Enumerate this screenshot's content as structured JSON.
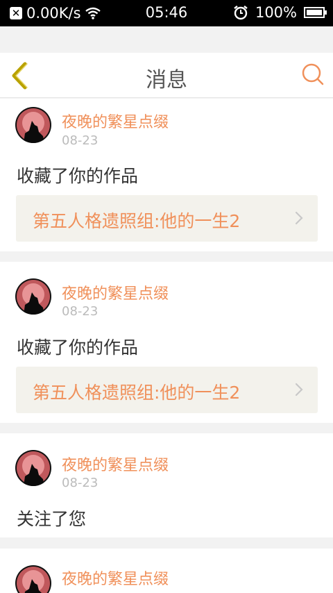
{
  "status_bar": {
    "speed": "0.00K/s",
    "time": "05:46",
    "battery": "100%",
    "icons": [
      "close-box-icon",
      "wifi-icon",
      "alarm-clock-icon",
      "battery-icon"
    ]
  },
  "nav": {
    "title": "消息",
    "back_icon": "chevron-left-icon",
    "search_icon": "search-icon",
    "accent_color": "#f0905a",
    "back_color": "#b9a200"
  },
  "messages": [
    {
      "user": "夜晚的繁星点缀",
      "date": "08-23",
      "action": "收藏了你的作品",
      "work": "第五人格遗照组:他的一生2"
    },
    {
      "user": "夜晚的繁星点缀",
      "date": "08-23",
      "action": "收藏了你的作品",
      "work": "第五人格遗照组:他的一生2"
    },
    {
      "user": "夜晚的繁星点缀",
      "date": "08-23",
      "action": "关注了您"
    },
    {
      "user": "夜晚的繁星点缀"
    }
  ]
}
